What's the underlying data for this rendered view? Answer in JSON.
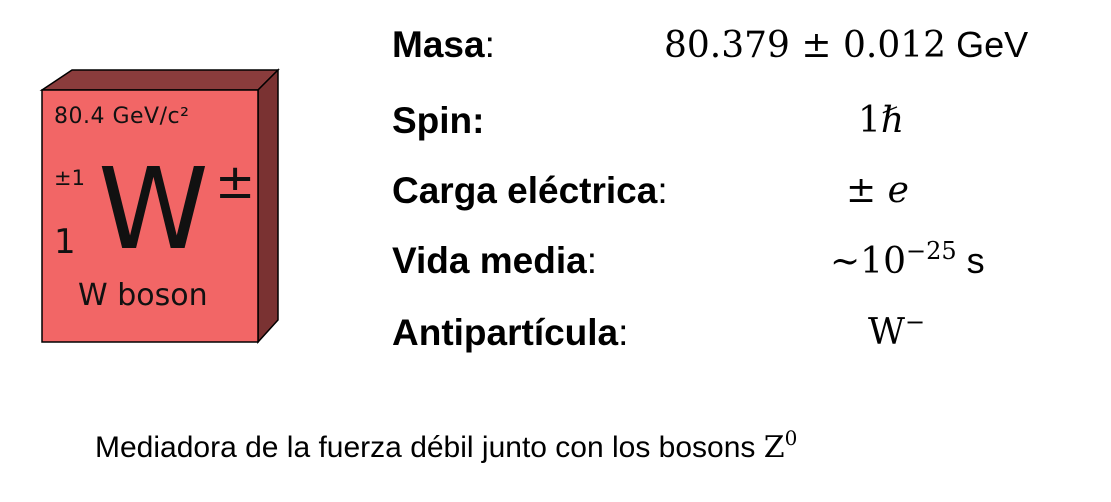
{
  "card": {
    "mass": "80.4 GeV/c²",
    "charge": "±1",
    "spin": "1",
    "symbol": "W",
    "symbol_sup": "±",
    "name": "W boson",
    "face_color": "#f26666",
    "side_color": "#7a3232",
    "top_color": "#8a3c3c"
  },
  "properties": [
    {
      "label": "Masa",
      "colon": ":",
      "value_main": "80.379 ± 0.012",
      "value_unit": " GeV"
    },
    {
      "label": "Spin:",
      "colon": "",
      "value_main": "1ℏ"
    },
    {
      "label": "Carga eléctrica",
      "colon": ":",
      "value_pre": "± ",
      "value_italic": "e"
    },
    {
      "label": "Vida media",
      "colon": ":",
      "value_main": "~10",
      "value_sup": "−25",
      "value_unit": " s"
    },
    {
      "label": "Antipartícula",
      "colon": ":",
      "value_main": "W",
      "value_sup": "−"
    }
  ],
  "footer": {
    "text": "Mediadora de la fuerza débil junto con los bosons ",
    "symbol": "Z",
    "symbol_sup": "0"
  }
}
